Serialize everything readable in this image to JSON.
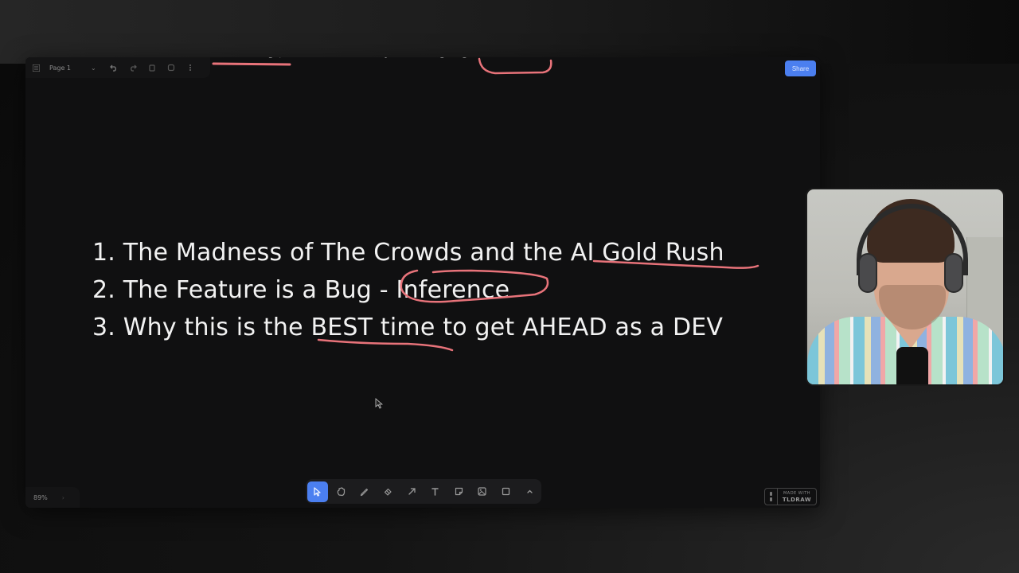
{
  "app": {
    "name": "tldraw",
    "page_name": "Page 1",
    "share_label": "Share",
    "zoom_level": "89%",
    "badge_line1": "MADE WITH",
    "badge_line2": "TLDRAW"
  },
  "menu": {
    "icons": [
      "menu-icon",
      "chevron-down-icon",
      "undo-icon",
      "redo-icon",
      "trash-icon",
      "duplicate-icon",
      "more-vertical-icon"
    ]
  },
  "canvas": {
    "top_partial_text": "sort of things, what do I see already tried using larger rules but doesn't seem to work",
    "list": [
      "1. The Madness of The Crowds and the AI Gold Rush",
      "2. The Feature is a Bug - Inference",
      "3. Why this is the BEST time to get AHEAD as a DEV"
    ],
    "annotation_color": "#e8737a",
    "annotations": [
      {
        "type": "underline",
        "target": "AI Gold Rush"
      },
      {
        "type": "circle",
        "target": "Inference"
      },
      {
        "type": "underline",
        "target": "BEST time"
      }
    ]
  },
  "toolbar": {
    "tools": [
      {
        "name": "select",
        "icon": "cursor-icon",
        "active": true
      },
      {
        "name": "hand",
        "icon": "hand-icon",
        "active": false
      },
      {
        "name": "draw",
        "icon": "pencil-icon",
        "active": false
      },
      {
        "name": "eraser",
        "icon": "eraser-icon",
        "active": false
      },
      {
        "name": "arrow",
        "icon": "arrow-icon",
        "active": false
      },
      {
        "name": "text",
        "icon": "text-icon",
        "active": false
      },
      {
        "name": "note",
        "icon": "sticky-note-icon",
        "active": false
      },
      {
        "name": "asset",
        "icon": "image-icon",
        "active": false
      },
      {
        "name": "rectangle",
        "icon": "rectangle-icon",
        "active": false
      },
      {
        "name": "more",
        "icon": "chevron-up-icon",
        "active": false
      }
    ]
  },
  "colors": {
    "accent": "#4b7ff0",
    "canvas_bg": "#101011",
    "text": "#f2f2f2",
    "annotation": "#e8737a"
  }
}
